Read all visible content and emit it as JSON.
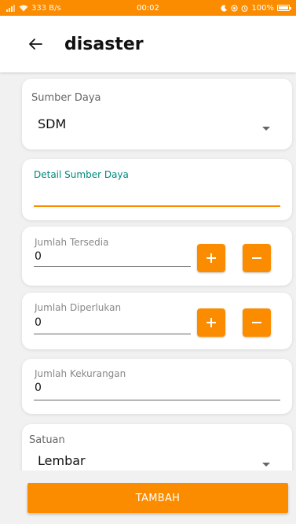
{
  "status_bar": {
    "left_text": "333 B/s",
    "time": "00:02",
    "battery": "100%"
  },
  "app_bar": {
    "title": "disaster",
    "back_icon": "arrow-left-icon"
  },
  "form": {
    "sumber_daya": {
      "label": "Sumber Daya",
      "value": "SDM"
    },
    "detail_sumber_daya": {
      "label": "Detail Sumber Daya",
      "value": ""
    },
    "jumlah_tersedia": {
      "label": "Jumlah Tersedia",
      "value": "0"
    },
    "jumlah_diperlukan": {
      "label": "Jumlah Diperlukan",
      "value": "0"
    },
    "jumlah_kekurangan": {
      "label": "Jumlah Kekurangan",
      "value": "0"
    },
    "satuan": {
      "label": "Satuan",
      "value": "Lembar"
    },
    "plus_label": "+",
    "minus_label": "−"
  },
  "actions": {
    "tambah_label": "TAMBAH"
  },
  "colors": {
    "accent": "#fb8c00",
    "focused_label": "#00897b",
    "background": "#f1f1f1"
  }
}
